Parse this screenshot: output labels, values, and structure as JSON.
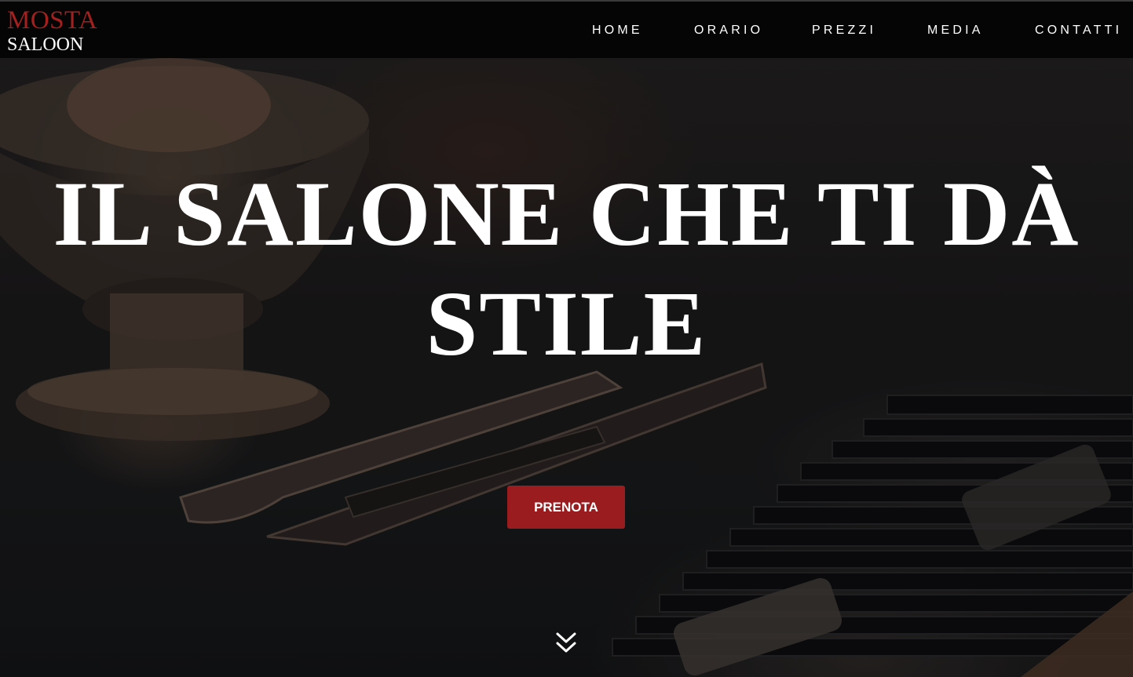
{
  "brand": {
    "line1": "MOSTA",
    "line2": "SALOON"
  },
  "nav": {
    "items": [
      {
        "label": "HOME"
      },
      {
        "label": "ORARIO"
      },
      {
        "label": "PREZZI"
      },
      {
        "label": "MEDIA"
      },
      {
        "label": "CONTATTI"
      }
    ]
  },
  "hero": {
    "headline_line1": "IL SALONE CHE TI DÀ",
    "headline_line2": "STILE",
    "cta_label": "PRENOTA",
    "scroll_icon": "double-chevron-down-icon"
  },
  "colors": {
    "accent": "#9a1c1f",
    "logo_red": "#a3201f",
    "nav_bg": "#050505",
    "text": "#ffffff"
  }
}
